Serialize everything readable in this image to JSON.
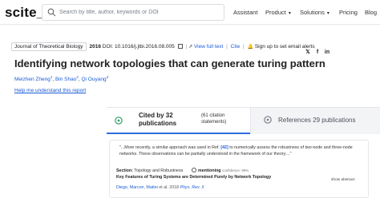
{
  "header": {
    "logo": "scite_",
    "search_placeholder": "Search by title, author, keywords or DOI",
    "nav": {
      "assistant": "Assistant",
      "product": "Product",
      "solutions": "Solutions",
      "pricing": "Pricing",
      "blog": "Blog"
    }
  },
  "article": {
    "journal": "Journal of Theoretical Biology",
    "year": "2016",
    "doi": "DOI: 10.1016/j.jtbi.2016.08.005",
    "view_fulltext": "View full text",
    "cite": "Cite",
    "signup": "Sign up to set email alerts",
    "title": "Identifying network topologies that can generate turing pattern",
    "authors": [
      {
        "name": "Meizhen Zheng",
        "sup": "1"
      },
      {
        "name": "Bin Shao",
        "sup": "2"
      },
      {
        "name": "Qi Ouyang",
        "sup": "3"
      }
    ],
    "help_link": "Help me understand this report"
  },
  "citations": {
    "cited_by": "Cited by 32 publications",
    "statements": "(61 citation statements)",
    "references": "References 29 publications",
    "statement": {
      "quote_pre": "\"...More recently, a similar approach was used in Ref.",
      "ref": "[42]",
      "quote_post": "to numerically assess the robustness of two-node and three-node networks. These observations can be partially understood in the framework of our theory....\"",
      "section_label": "Section:",
      "section_value": "Topology and Robustness",
      "type": "mentioning",
      "confidence": "confidence: 99%",
      "paper_title": "Key Features of Turing Systems are Determined Purely by Network Topology",
      "paper_authors": "Diego",
      "paper_authors_2": "Marcon",
      "paper_authors_3": "Mattei",
      "paper_authors_suffix": "et al. 2018",
      "paper_journal": "Phys. Rev. X",
      "show_abstract": "show abstract"
    }
  },
  "colors": {
    "link": "#1a5bd6",
    "tab_active_underline": "#2d6cdf",
    "mentioning": "#555555"
  }
}
